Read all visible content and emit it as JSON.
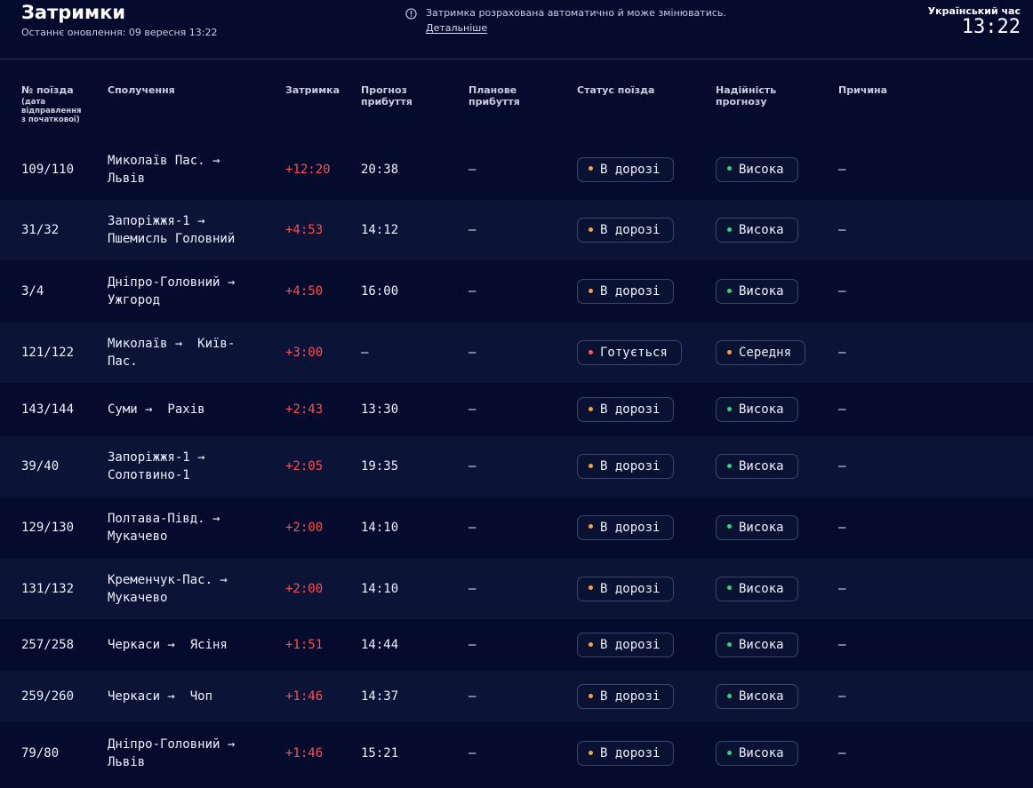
{
  "header": {
    "title": "Затримки",
    "updated": "Останнє оновлення: 09 вересня 13:22",
    "notice_text": "Затримка розрахована автоматично й може змінюватись.",
    "notice_link": "Детальніше",
    "clock_label": "Український час",
    "clock_time": "13:22"
  },
  "columns": {
    "train_number": "№ поїзда",
    "train_number_sub_1": "(дата",
    "train_number_sub_2": "відправлення",
    "train_number_sub_3": "з початкової)",
    "route": "Сполучення",
    "delay": "Затримка",
    "forecast_1": "Прогноз",
    "forecast_2": "прибуття",
    "planned_1": "Планове",
    "planned_2": "прибуття",
    "status": "Статус поїзда",
    "reliability_1": "Надійність",
    "reliability_2": "прогнозу",
    "reason": "Причина"
  },
  "colors": {
    "background": "#050b2d",
    "row_alt": "#0b1337",
    "delay_red": "#ff4e4e",
    "dot_orange": "#f5a04a",
    "dot_red": "#ff5a4e",
    "dot_green": "#36d17a",
    "pill_border": "#3b4570"
  },
  "rows": [
    {
      "number": "109/110",
      "route_1": "Миколаїв Пас. →",
      "route_2": "Львів",
      "delay": "+12:20",
      "forecast": "20:38",
      "planned": "—",
      "status": "В дорозі",
      "status_dot": "orange",
      "reliability": "Висока",
      "reliability_dot": "green",
      "reason": "—"
    },
    {
      "number": "31/32",
      "route_1": "Запоріжжя-1 →",
      "route_2": "Пшемисль Головний",
      "delay": "+4:53",
      "forecast": "14:12",
      "planned": "—",
      "status": "В дорозі",
      "status_dot": "orange",
      "reliability": "Висока",
      "reliability_dot": "green",
      "reason": "—"
    },
    {
      "number": "3/4",
      "route_1": "Дніпро-Головний →",
      "route_2": "Ужгород",
      "delay": "+4:50",
      "forecast": "16:00",
      "planned": "—",
      "status": "В дорозі",
      "status_dot": "orange",
      "reliability": "Висока",
      "reliability_dot": "green",
      "reason": "—"
    },
    {
      "number": "121/122",
      "route_1": "Миколаїв →  Київ-",
      "route_2": "Пас.",
      "delay": "+3:00",
      "forecast": "—",
      "planned": "—",
      "status": "Готується",
      "status_dot": "red",
      "reliability": "Середня",
      "reliability_dot": "orange",
      "reason": "—"
    },
    {
      "number": "143/144",
      "route_1": "Суми →  Рахів",
      "route_2": "",
      "delay": "+2:43",
      "forecast": "13:30",
      "planned": "—",
      "status": "В дорозі",
      "status_dot": "orange",
      "reliability": "Висока",
      "reliability_dot": "green",
      "reason": "—"
    },
    {
      "number": "39/40",
      "route_1": "Запоріжжя-1 →",
      "route_2": "Солотвино-1",
      "delay": "+2:05",
      "forecast": "19:35",
      "planned": "—",
      "status": "В дорозі",
      "status_dot": "orange",
      "reliability": "Висока",
      "reliability_dot": "green",
      "reason": "—"
    },
    {
      "number": "129/130",
      "route_1": "Полтава-Півд. →",
      "route_2": "Мукачево",
      "delay": "+2:00",
      "forecast": "14:10",
      "planned": "—",
      "status": "В дорозі",
      "status_dot": "orange",
      "reliability": "Висока",
      "reliability_dot": "green",
      "reason": "—"
    },
    {
      "number": "131/132",
      "route_1": "Кременчук-Пас. →",
      "route_2": "Мукачево",
      "delay": "+2:00",
      "forecast": "14:10",
      "planned": "—",
      "status": "В дорозі",
      "status_dot": "orange",
      "reliability": "Висока",
      "reliability_dot": "green",
      "reason": "—"
    },
    {
      "number": "257/258",
      "route_1": "Черкаси →  Ясіня",
      "route_2": "",
      "delay": "+1:51",
      "forecast": "14:44",
      "planned": "—",
      "status": "В дорозі",
      "status_dot": "orange",
      "reliability": "Висока",
      "reliability_dot": "green",
      "reason": "—"
    },
    {
      "number": "259/260",
      "route_1": "Черкаси →  Чоп",
      "route_2": "",
      "delay": "+1:46",
      "forecast": "14:37",
      "planned": "—",
      "status": "В дорозі",
      "status_dot": "orange",
      "reliability": "Висока",
      "reliability_dot": "green",
      "reason": "—"
    },
    {
      "number": "79/80",
      "route_1": "Дніпро-Головний →",
      "route_2": "Львів",
      "delay": "+1:46",
      "forecast": "15:21",
      "planned": "—",
      "status": "В дорозі",
      "status_dot": "orange",
      "reliability": "Висока",
      "reliability_dot": "green",
      "reason": "—"
    }
  ]
}
